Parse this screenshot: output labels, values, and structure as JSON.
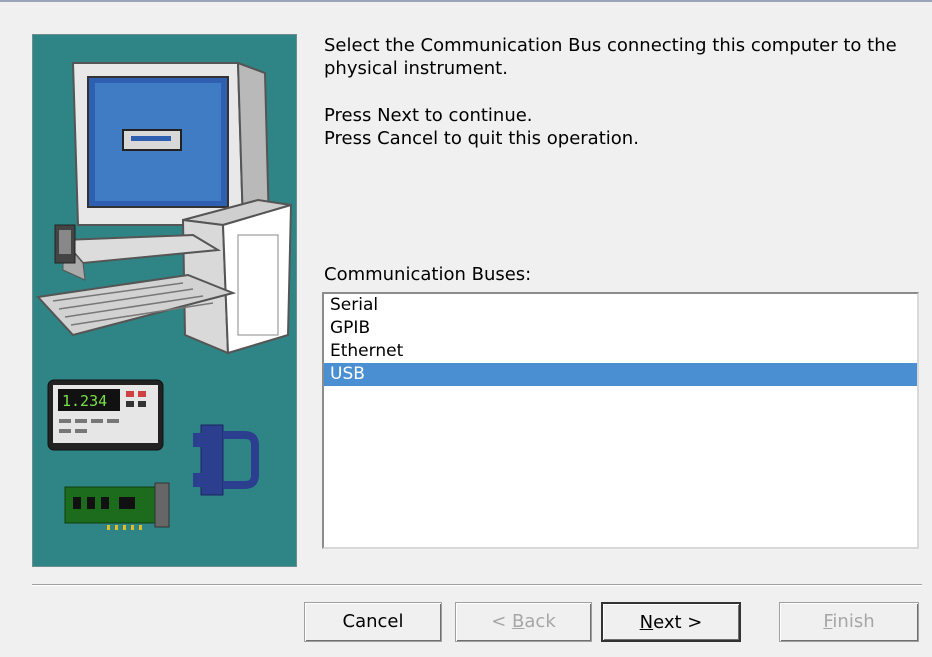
{
  "instructions": {
    "line1": "Select the Communication Bus connecting this computer to the physical instrument.",
    "line2": "Press Next to continue.",
    "line3": "Press Cancel to quit this operation."
  },
  "list": {
    "label": "Communication Buses:",
    "items": [
      "Serial",
      "GPIB",
      "Ethernet",
      "USB"
    ],
    "selected": "USB"
  },
  "image": {
    "meter_display": "1.234"
  },
  "buttons": {
    "cancel": "Cancel",
    "back_prefix": "< ",
    "back_key": "B",
    "back_rest": "ack",
    "next_key": "N",
    "next_rest": "ext >",
    "finish_key": "F",
    "finish_rest": "inish"
  },
  "colors": {
    "image_background": "#2f8585",
    "selection": "#4a8fd2"
  }
}
